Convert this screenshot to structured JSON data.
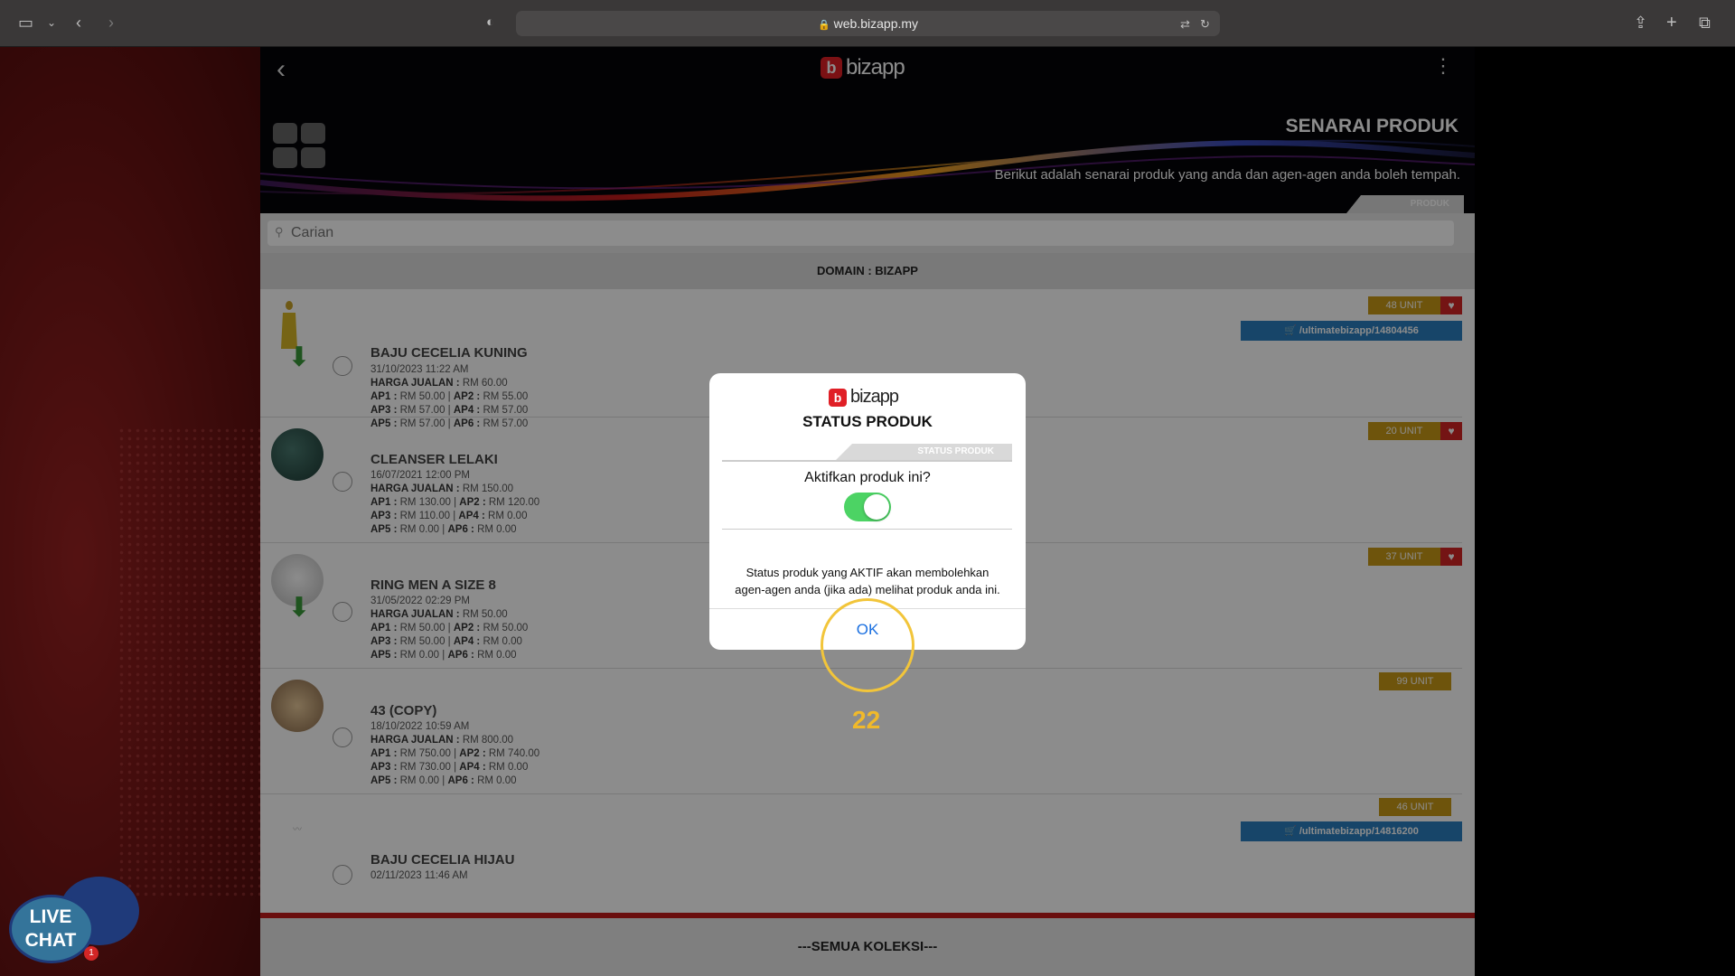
{
  "browser": {
    "url": "web.bizapp.my"
  },
  "app": {
    "logo_text": "bizapp",
    "logo_mark": "b",
    "page_title": "SENARAI PRODUK",
    "page_subtitle": "Berikut adalah senarai produk yang anda dan agen-agen anda boleh tempah.",
    "tab_label": "PRODUK",
    "search_placeholder": "Carian",
    "domain_label": "DOMAIN : BIZAPP",
    "footer_label": "---SEMUA KOLEKSI---"
  },
  "products": [
    {
      "name": "BAJU CECELIA KUNING",
      "date": "31/10/2023 11:22 AM",
      "harga": "RM 60.00",
      "ap1": "RM 50.00",
      "ap2": "RM 55.00",
      "ap3": "RM 57.00",
      "ap4": "RM 57.00",
      "ap5": "RM 57.00",
      "ap6": "RM 57.00",
      "units": "48 UNIT",
      "link": "/ultimatebizapp/14804456"
    },
    {
      "name": "CLEANSER LELAKI",
      "date": "16/07/2021 12:00 PM",
      "harga": "RM 150.00",
      "ap1": "RM 130.00",
      "ap2": "RM 120.00",
      "ap3": "RM 110.00",
      "ap4": "RM 0.00",
      "ap5": "RM 0.00",
      "ap6": "RM 0.00",
      "units": "20 UNIT"
    },
    {
      "name": "RING MEN A SIZE 8",
      "date": "31/05/2022 02:29 PM",
      "harga": "RM 50.00",
      "ap1": "RM 50.00",
      "ap2": "RM 50.00",
      "ap3": "RM 50.00",
      "ap4": "RM 0.00",
      "ap5": "RM 0.00",
      "ap6": "RM 0.00",
      "units": "37 UNIT"
    },
    {
      "name": "43 (COPY)",
      "date": "18/10/2022 10:59 AM",
      "harga": "RM 800.00",
      "ap1": "RM 750.00",
      "ap2": "RM 740.00",
      "ap3": "RM 730.00",
      "ap4": "RM 0.00",
      "ap5": "RM 0.00",
      "ap6": "RM 0.00",
      "units": "99 UNIT"
    },
    {
      "name": "BAJU CECELIA HIJAU",
      "date": "02/11/2023 11:46 AM",
      "units": "46 UNIT",
      "link": "/ultimatebizapp/14816200"
    }
  ],
  "labels": {
    "harga": "HARGA JUALAN :",
    "ap1": "AP1 :",
    "ap2": "AP2 :",
    "ap3": "AP3 :",
    "ap4": "AP4 :",
    "ap5": "AP5 :",
    "ap6": "AP6 :"
  },
  "modal": {
    "title": "STATUS PRODUK",
    "tab_label": "STATUS PRODUK",
    "question": "Aktifkan produk ini?",
    "toggle_on": true,
    "description_line1": "Status produk yang AKTIF akan membolehkan",
    "description_line2": "agen-agen anda (jika ada) melihat produk anda ini.",
    "ok_label": "OK"
  },
  "annotation": {
    "step_number": "22"
  },
  "livechat": {
    "line1": "LIVE",
    "line2": "CHAT",
    "badge": "1"
  },
  "colors": {
    "unit_badge": "#c99a16",
    "heart": "#d32626",
    "link": "#2a7fbf",
    "toggle": "#4cd364",
    "ok": "#1a6fe0",
    "highlight": "#f2c53a"
  }
}
